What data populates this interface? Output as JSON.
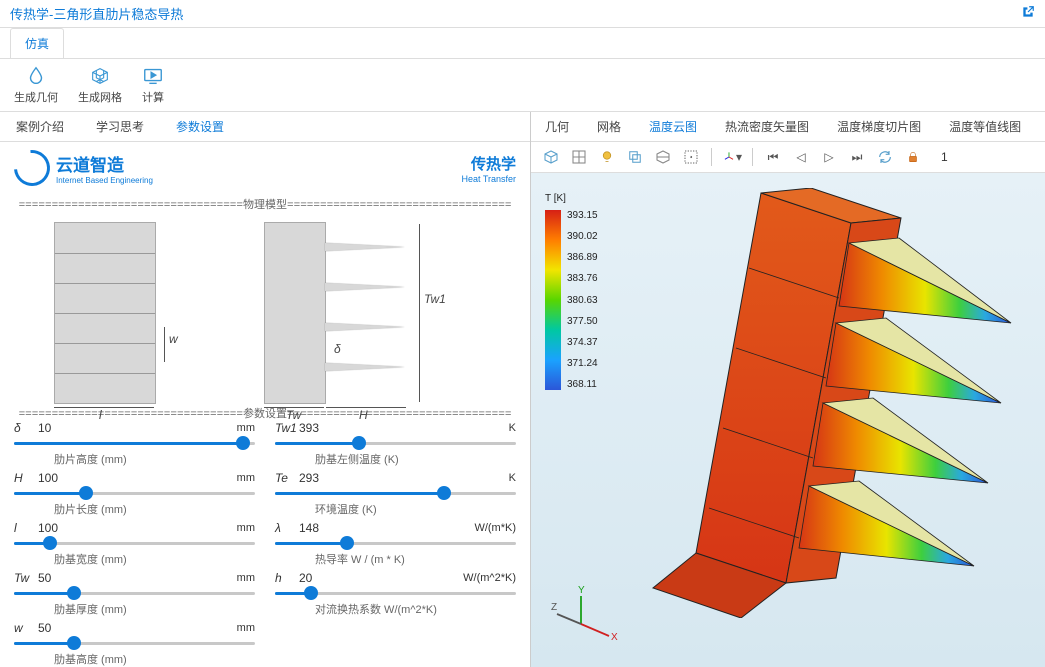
{
  "header": {
    "title": "传热学-三角形直肋片稳态导热",
    "extIcon": "external-link-icon"
  },
  "topTab": "仿真",
  "ribbon": [
    {
      "icon": "drop",
      "label": "生成几何"
    },
    {
      "icon": "cube",
      "label": "生成网格"
    },
    {
      "icon": "play",
      "label": "计算"
    }
  ],
  "leftTabs": [
    "案例介绍",
    "学习思考",
    "参数设置"
  ],
  "leftActive": 2,
  "logo": {
    "cn": "云道智造",
    "en": "Internet Based Engineering"
  },
  "heatLogo": {
    "cn": "传热学",
    "en": "Heat Transfer"
  },
  "section1": "==================================物理模型==================================",
  "section2": "==================================参数设置==================================",
  "diagramLabels": {
    "w": "w",
    "l": "l",
    "Tw": "Tw",
    "H": "H",
    "Tw1": "Tw1",
    "delta": "δ"
  },
  "params": [
    {
      "sym": "δ",
      "val": "10",
      "unit": "mm",
      "desc": "肋片高度 (mm)",
      "fill": 95
    },
    {
      "sym": "Tw1",
      "val": "393",
      "unit": "K",
      "desc": "肋基左侧温度 (K)",
      "fill": 35
    },
    {
      "sym": "H",
      "val": "100",
      "unit": "mm",
      "desc": "肋片长度 (mm)",
      "fill": 30
    },
    {
      "sym": "Te",
      "val": "293",
      "unit": "K",
      "desc": "环境温度 (K)",
      "fill": 70
    },
    {
      "sym": "l",
      "val": "100",
      "unit": "mm",
      "desc": "肋基宽度 (mm)",
      "fill": 15
    },
    {
      "sym": "λ",
      "val": "148",
      "unit": "W/(m*K)",
      "desc": "热导率 W / (m * K)",
      "fill": 30
    },
    {
      "sym": "Tw",
      "val": "50",
      "unit": "mm",
      "desc": "肋基厚度 (mm)",
      "fill": 25
    },
    {
      "sym": "h",
      "val": "20",
      "unit": "W/(m^2*K)",
      "desc": "对流换热系数 W/(m^2*K)",
      "fill": 15
    },
    {
      "sym": "w",
      "val": "50",
      "unit": "mm",
      "desc": "肋基高度 (mm)",
      "fill": 25
    }
  ],
  "rightTabs": [
    "几何",
    "网格",
    "温度云图",
    "热流密度矢量图",
    "温度梯度切片图",
    "温度等值线图"
  ],
  "rightActive": 2,
  "viewCount": "1",
  "legend": {
    "title": "T [K]",
    "ticks": [
      "393.15",
      "390.02",
      "386.89",
      "383.76",
      "380.63",
      "377.50",
      "374.37",
      "371.24",
      "368.11"
    ]
  },
  "axisLabels": {
    "x": "X",
    "y": "Y",
    "z": "Z"
  }
}
